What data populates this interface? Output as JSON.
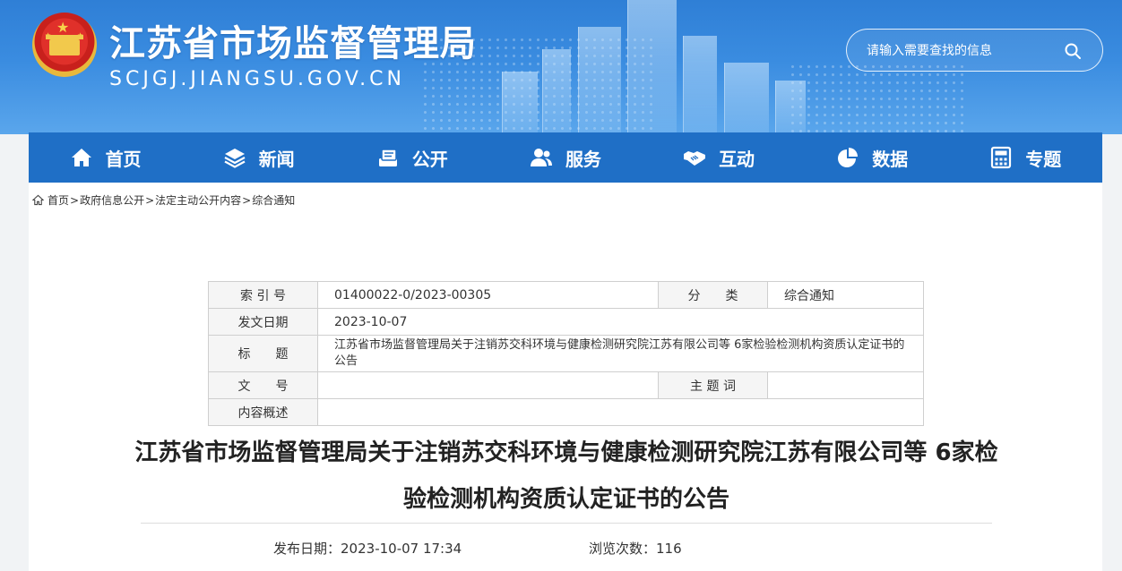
{
  "header": {
    "title": "江苏省市场监督管理局",
    "domain": "SCJGJ.JIANGSU.GOV.CN"
  },
  "search": {
    "placeholder": "请输入需要查找的信息",
    "icon": "search-icon"
  },
  "nav": {
    "items": [
      {
        "label": "首页",
        "icon": "home-icon"
      },
      {
        "label": "新闻",
        "icon": "layers-icon"
      },
      {
        "label": "公开",
        "icon": "document-stack-icon"
      },
      {
        "label": "服务",
        "icon": "people-icon"
      },
      {
        "label": "互动",
        "icon": "handshake-icon"
      },
      {
        "label": "数据",
        "icon": "pie-chart-icon"
      },
      {
        "label": "专题",
        "icon": "calculator-icon"
      }
    ]
  },
  "breadcrumb": {
    "items": [
      "首页",
      "政府信息公开",
      "法定主动公开内容",
      "综合通知"
    ],
    "separator": ">"
  },
  "meta": {
    "index_label": "索 引 号",
    "index_value": "01400022-0/2023-00305",
    "category_label": "分　　类",
    "category_value": "综合通知",
    "date_label": "发文日期",
    "date_value": "2023-10-07",
    "title_label": "标　　题",
    "title_value": "江苏省市场监督管理局关于注销苏交科环境与健康检测研究院江苏有限公司等 6家检验检测机构资质认定证书的公告",
    "docno_label": "文　　号",
    "docno_value": "",
    "keywords_label": "主 题 词",
    "keywords_value": "",
    "summary_label": "内容概述",
    "summary_value": ""
  },
  "article": {
    "title": "江苏省市场监督管理局关于注销苏交科环境与健康检测研究院江苏有限公司等 6家检验检测机构资质认定证书的公告",
    "publish_label": "发布日期：",
    "publish_value": "2023-10-07 17:34",
    "views_label": "浏览次数：",
    "views_value": "116"
  },
  "colors": {
    "nav_bg": "#1f6fc6",
    "header_bg": "#3a8ce0"
  }
}
